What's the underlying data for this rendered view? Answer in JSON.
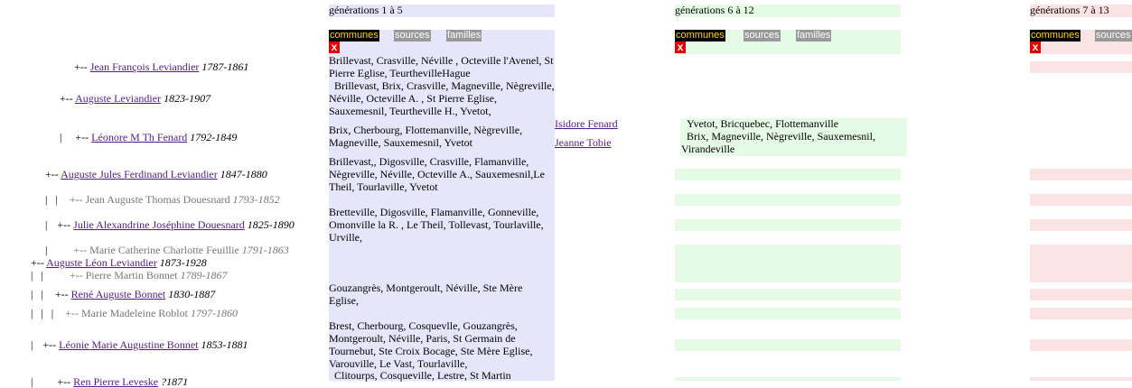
{
  "columns": [
    {
      "header": "générations 1 à 5",
      "tabs": [
        "communes",
        "sources",
        "familles"
      ],
      "close": "x"
    },
    {
      "header": "générations 6 à 12",
      "tabs": [
        "communes",
        "sources",
        "familles"
      ],
      "close": "x"
    },
    {
      "header": "générations 7 à 13",
      "tabs": [
        "communes",
        "sources"
      ],
      "close": "x"
    }
  ],
  "tree": [
    {
      "prefix": "+--",
      "name": "Jean François Leviandier",
      "years": "1787-1861",
      "link": true
    },
    {
      "prefix": "+--",
      "name": "Auguste Leviandier",
      "years": "1823-1907",
      "link": true
    },
    {
      "prefix": "|",
      "prefix2": "+--",
      "name": "Léonore M Th Fenard",
      "years": "1792-1849",
      "link": true
    },
    {
      "prefix": "+--",
      "name": "Auguste Jules Ferdinand Leviandier",
      "years": "1847-1880",
      "link": true
    },
    {
      "prefix": "|   |",
      "prefix2": "+--",
      "name": "Jean Auguste Thomas Douesnard",
      "years": "1793-1852",
      "link": false
    },
    {
      "prefix": "|",
      "prefix2": "+--",
      "name": "Julie Alexandrine Joséphine Douesnard",
      "years": "1825-1890",
      "link": true
    },
    {
      "prefix": "|",
      "prefix2": "+--",
      "name": "Marie Catherine Charlotte Feuillie",
      "years": "1791-1863",
      "link": false
    },
    {
      "prefix": "+--",
      "name": "Auguste Léon Leviandier",
      "years": "1873-1928",
      "link": true
    },
    {
      "prefix": "|   |",
      "prefix2": "+--",
      "name": "Pierre Martin Bonnet",
      "years": "1789-1867",
      "link": false
    },
    {
      "prefix": "|   |",
      "prefix2": "+--",
      "name": "René Auguste Bonnet",
      "years": "1830-1887",
      "link": true
    },
    {
      "prefix": "|   |   |",
      "prefix2": "+--",
      "name": "Marie Madeleine Roblot",
      "years": "1797-1860",
      "link": false
    },
    {
      "prefix": "|",
      "prefix2": "+--",
      "name": "Léonie Marie Augustine Bonnet",
      "years": "1853-1881",
      "link": true
    },
    {
      "prefix": "|",
      "prefix2": "+--",
      "name": "Ren Pierre Leveske",
      "years": "?1871",
      "link": true
    }
  ],
  "communes": [
    "Brillevast, Crasville, Néville , Octeville l'Avenel, St Pierre Eglise, TeurthevilleHague",
    "  Brillevast, Brix, Crasville, Magneville, Nègreville, Néville, Octeville A. , St Pierre Eglise, Sauxemesnil, Teurtheville H., Yvetot,",
    "Brix, Cherbourg, Flottemanville, Nègreville, Magneville, Sauxemesnil, Yvetot",
    "Brillevast,, Digosville, Crasville, Flamanville, Nègreville, Néville, Octeville A., Sauxemesnil,Le Theil, Tourlaville, Yvetot",
    "Bretteville, Digosville, Flamanville, Gonneville, Omonville la R. , Le Theil, Tollevast, Tourlaville, Urville,",
    "Gouzangrès, Montgeroult, Néville, Ste Mère Eglise,",
    "Brest, Cherbourg, Cosquevlle, Gouzangrès, Montgeroult, Néville, Paris, St Germain de Tournebut, Ste Croix Bocage, Ste Mère Eglise, Varouville, Le Vast, Tourlaville,",
    "  Clitourps, Cosqueville, Lestre, St Martin"
  ],
  "parents": [
    "Isidore Fenard",
    "Jeanne Tobie"
  ],
  "communes_gen6": [
    "  Yvetot, Bricquebec, Flottemanville",
    "  Brix, Magneville, Nègreville, Sauxemesnil, Virandeville"
  ]
}
